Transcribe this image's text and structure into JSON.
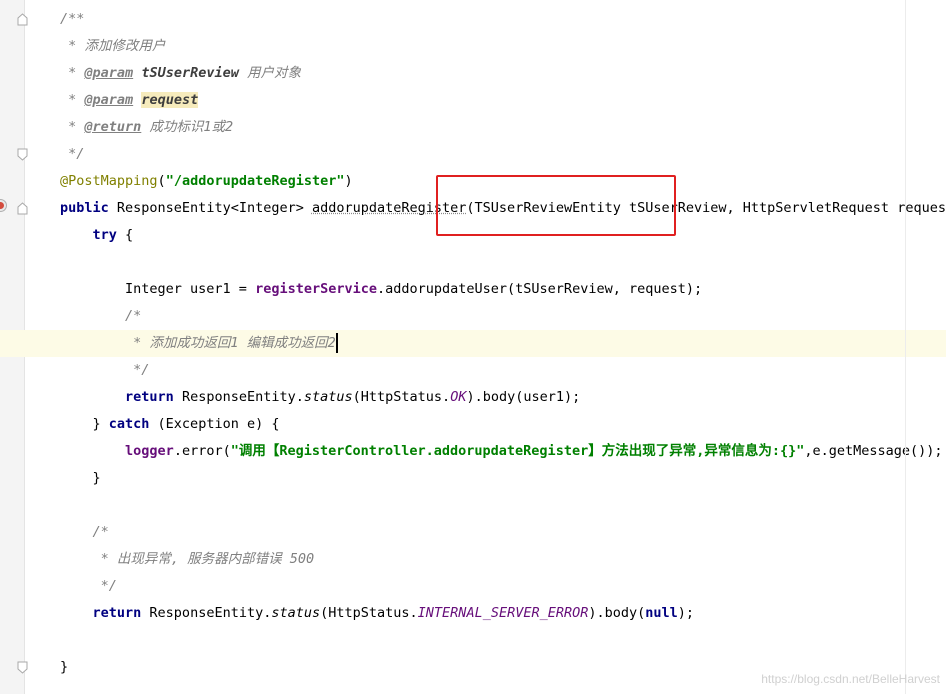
{
  "editor": {
    "code_lines": [
      {
        "segments": [
          {
            "t": "/**",
            "c": "cm"
          }
        ]
      },
      {
        "segments": [
          {
            "t": " * 添加修改用户",
            "c": "cm"
          }
        ]
      },
      {
        "segments": [
          {
            "t": " * ",
            "c": "cm"
          },
          {
            "t": "@param",
            "c": "tag"
          },
          {
            "t": " ",
            "c": "cm"
          },
          {
            "t": "tSUserReview",
            "c": "pname"
          },
          {
            "t": " 用户对象",
            "c": "cm"
          }
        ]
      },
      {
        "segments": [
          {
            "t": " * ",
            "c": "cm"
          },
          {
            "t": "@param",
            "c": "tag"
          },
          {
            "t": " ",
            "c": "cm"
          },
          {
            "t": "request",
            "c": "pname hl"
          }
        ]
      },
      {
        "segments": [
          {
            "t": " * ",
            "c": "cm"
          },
          {
            "t": "@return",
            "c": "tag"
          },
          {
            "t": " 成功标识1或2",
            "c": "cm"
          }
        ]
      },
      {
        "segments": [
          {
            "t": " */",
            "c": "cm"
          }
        ]
      },
      {
        "segments": [
          {
            "t": "@PostMapping",
            "c": "ann"
          },
          {
            "t": "(",
            "c": "plain"
          },
          {
            "t": "\"/addorupdateRegister\"",
            "c": "str"
          },
          {
            "t": ")",
            "c": "plain"
          }
        ]
      },
      {
        "segments": [
          {
            "t": "public",
            "c": "kw"
          },
          {
            "t": " ResponseEntity<Integer> ",
            "c": "plain"
          },
          {
            "t": "addorupdateRegister",
            "c": "plain und"
          },
          {
            "t": "(TSUserReviewEntity tSUserReview, HttpServletRequest request) {",
            "c": "plain"
          }
        ]
      },
      {
        "segments": [
          {
            "t": "    ",
            "c": "plain"
          },
          {
            "t": "try",
            "c": "kw"
          },
          {
            "t": " {",
            "c": "plain"
          }
        ]
      },
      {
        "segments": []
      },
      {
        "segments": [
          {
            "t": "        Integer user1 = ",
            "c": "plain"
          },
          {
            "t": "registerService",
            "c": "fld"
          },
          {
            "t": ".addorupdateUser(tSUserReview, request);",
            "c": "plain"
          }
        ]
      },
      {
        "segments": [
          {
            "t": "        /*",
            "c": "cm"
          }
        ]
      },
      {
        "segments": [
          {
            "t": "         * 添加成功返回1 编辑成功返回2",
            "c": "cm"
          }
        ],
        "current": true
      },
      {
        "segments": [
          {
            "t": "         */",
            "c": "cm"
          }
        ]
      },
      {
        "segments": [
          {
            "t": "        ",
            "c": "plain"
          },
          {
            "t": "return",
            "c": "kw"
          },
          {
            "t": " ResponseEntity.",
            "c": "plain"
          },
          {
            "t": "status",
            "c": "sfn"
          },
          {
            "t": "(HttpStatus.",
            "c": "plain"
          },
          {
            "t": "OK",
            "c": "cst"
          },
          {
            "t": ").body(user1);",
            "c": "plain"
          }
        ]
      },
      {
        "segments": [
          {
            "t": "    } ",
            "c": "plain"
          },
          {
            "t": "catch",
            "c": "kw"
          },
          {
            "t": " (Exception e) {",
            "c": "plain"
          }
        ]
      },
      {
        "segments": [
          {
            "t": "        ",
            "c": "plain"
          },
          {
            "t": "logger",
            "c": "fld"
          },
          {
            "t": ".error(",
            "c": "plain"
          },
          {
            "t": "\"调用【RegisterController.addorupdateRegister】方法出现了异常,异常信息为:{}\"",
            "c": "str"
          },
          {
            "t": ",e.getMessage());",
            "c": "plain"
          }
        ]
      },
      {
        "segments": [
          {
            "t": "    }",
            "c": "plain"
          }
        ]
      },
      {
        "segments": []
      },
      {
        "segments": [
          {
            "t": "    /*",
            "c": "cm"
          }
        ]
      },
      {
        "segments": [
          {
            "t": "     * 出现异常, 服务器内部错误 500",
            "c": "cm"
          }
        ]
      },
      {
        "segments": [
          {
            "t": "     */",
            "c": "cm"
          }
        ]
      },
      {
        "segments": [
          {
            "t": "    ",
            "c": "plain"
          },
          {
            "t": "return",
            "c": "kw"
          },
          {
            "t": " ResponseEntity.",
            "c": "plain"
          },
          {
            "t": "status",
            "c": "sfn"
          },
          {
            "t": "(HttpStatus.",
            "c": "plain"
          },
          {
            "t": "INTERNAL_SERVER_ERROR",
            "c": "cst"
          },
          {
            "t": ").body(",
            "c": "plain"
          },
          {
            "t": "null",
            "c": "kw"
          },
          {
            "t": ");",
            "c": "plain"
          }
        ]
      },
      {
        "segments": []
      },
      {
        "segments": [
          {
            "t": "}",
            "c": "plain"
          }
        ]
      }
    ]
  },
  "colors": {
    "keyword": "#000080",
    "comment": "#808080",
    "annotation": "#808000",
    "string": "#008000",
    "field": "#660e7a",
    "highlight_box": "#e02020",
    "current_line": "#fdfbe6",
    "gutter": "#f4f4f4"
  },
  "icons": {
    "breakpoint": "breakpoint-icon",
    "fold": "fold-marker-icon"
  },
  "watermark": "https://blog.csdn.net/BelleHarvest"
}
